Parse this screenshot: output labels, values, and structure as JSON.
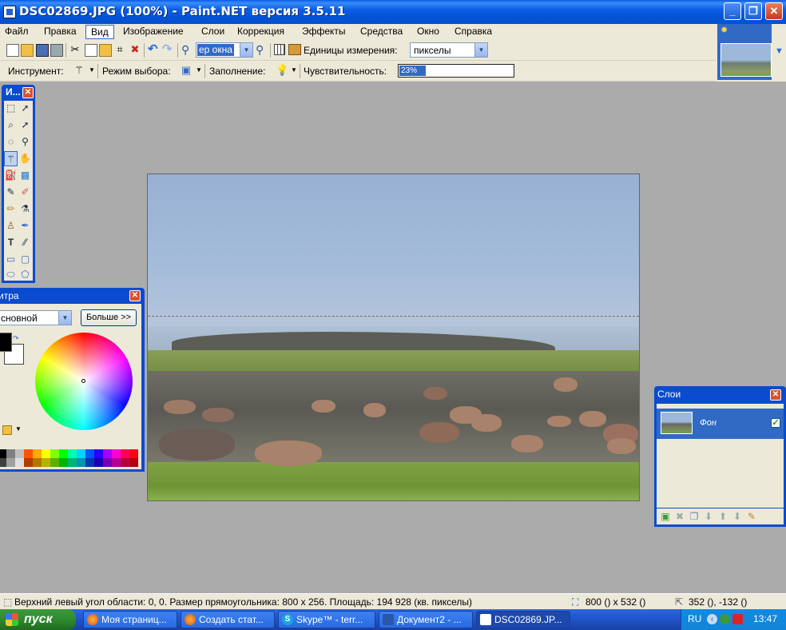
{
  "window": {
    "title": "DSC02869.JPG (100%) - Paint.NET версия 3.5.11",
    "min_glyph": "_",
    "max_glyph": "❐",
    "close_glyph": "✕"
  },
  "menu": [
    "Файл",
    "Правка",
    "Вид",
    "Изображение",
    "Слои",
    "Коррекция",
    "Эффекты",
    "Средства",
    "Окно",
    "Справка"
  ],
  "menu_active_index": 2,
  "toolbar1": {
    "zoom_value": "ер окна",
    "units_label": "Единицы измерения:",
    "units_value": "пикселы"
  },
  "toolbar2": {
    "tool_label": "Инструмент:",
    "selection_mode_label": "Режим выбора:",
    "fill_label": "Заполнение:",
    "sensitivity_label": "Чувствительность:",
    "sensitivity_value": "23%",
    "sensitivity_fraction": 0.23
  },
  "tools_window": {
    "caption": "И...",
    "close_glyph": "✕"
  },
  "palette_window": {
    "caption": "итра",
    "close_glyph": "✕",
    "mode_value": "сновной",
    "more_button": "Больше >>",
    "primary_color": "#000000",
    "secondary_color": "#ffffff"
  },
  "layers_window": {
    "caption": "Слои",
    "close_glyph": "✕",
    "layer_name": "Фон",
    "layer_visible": true
  },
  "status": {
    "selection_info": "Верхний левый угол области: 0, 0. Размер прямоугольника: 800 x 256. Площадь: 194 928 (кв. пикселы)",
    "image_size": "800 () x 532 ()",
    "cursor_pos": "352 (), -132 ()"
  },
  "taskbar": {
    "start_label": "пуск",
    "tasks": [
      {
        "label": "Моя страниц...",
        "icon": "firefox-icon"
      },
      {
        "label": "Создать стат...",
        "icon": "firefox-icon"
      },
      {
        "label": "Skype™ - terr...",
        "icon": "skype-icon"
      },
      {
        "label": "Документ2 - ...",
        "icon": "word-icon"
      },
      {
        "label": "DSC02869.JP...",
        "icon": "paintnet-icon"
      }
    ],
    "active_task_index": 4,
    "lang": "RU",
    "clock": "13:47"
  },
  "colors": {
    "titlebar": "#0a5be4",
    "selection_blue": "#316ac5",
    "window_face": "#ece9d8",
    "workspace": "#ababab"
  }
}
